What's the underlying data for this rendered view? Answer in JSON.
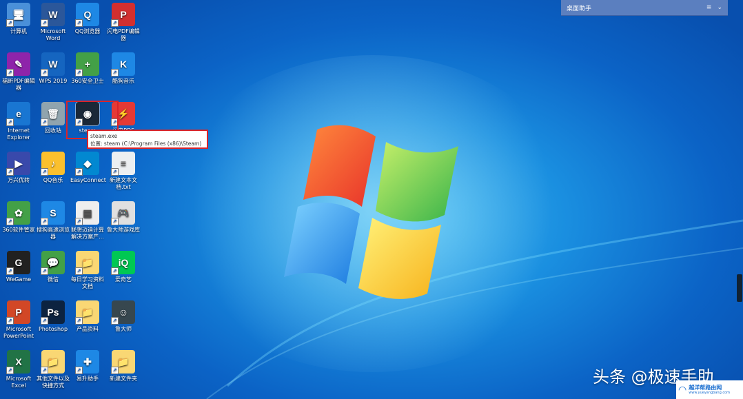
{
  "desktop": {
    "icons": [
      {
        "label": "计算机",
        "icon": "computer-icon",
        "color": "#4a90d9",
        "glyph": "🖥"
      },
      {
        "label": "Microsoft Word",
        "icon": "word-icon",
        "color": "#2b579a",
        "glyph": "W"
      },
      {
        "label": "QQ浏览器",
        "icon": "qq-browser-icon",
        "color": "#1e88e5",
        "glyph": "Q"
      },
      {
        "label": "闪电PDF编辑器",
        "icon": "pdf-editor-icon",
        "color": "#d32f2f",
        "glyph": "P"
      },
      {
        "label": "福昕PDF编辑器",
        "icon": "foxit-icon",
        "color": "#8e24aa",
        "glyph": "✎"
      },
      {
        "label": "WPS 2019",
        "icon": "wps-icon",
        "color": "#1565c0",
        "glyph": "W"
      },
      {
        "label": "360安全卫士",
        "icon": "360-safe-icon",
        "color": "#43a047",
        "glyph": "+"
      },
      {
        "label": "酷狗音乐",
        "icon": "kugou-icon",
        "color": "#1e88e5",
        "glyph": "K"
      },
      {
        "label": "Internet Explorer",
        "icon": "ie-icon",
        "color": "#1976d2",
        "glyph": "e"
      },
      {
        "label": "回收站",
        "icon": "recycle-bin-icon",
        "color": "#90a4ae",
        "glyph": "🗑"
      },
      {
        "label": "steam",
        "icon": "steam-icon",
        "color": "#1b2838",
        "glyph": "◉"
      },
      {
        "label": "闪电PDF",
        "icon": "pdf-icon",
        "color": "#e53935",
        "glyph": "⚡"
      },
      {
        "label": "万兴优转",
        "icon": "converter-icon",
        "color": "#3949ab",
        "glyph": "▶"
      },
      {
        "label": "QQ音乐",
        "icon": "qq-music-icon",
        "color": "#fbc02d",
        "glyph": "♪"
      },
      {
        "label": "EasyConnect",
        "icon": "easyconnect-icon",
        "color": "#0288d1",
        "glyph": "◆"
      },
      {
        "label": "新建文本文档.txt",
        "icon": "text-file-icon",
        "color": "#eceff1",
        "glyph": "≡"
      },
      {
        "label": "360软件管家",
        "icon": "360-manager-icon",
        "color": "#43a047",
        "glyph": "✿"
      },
      {
        "label": "搜狗高速浏览器",
        "icon": "sogou-icon",
        "color": "#1e88e5",
        "glyph": "S"
      },
      {
        "label": "联想迈迪计算解决方案产...",
        "icon": "document-icon",
        "color": "#eeeeee",
        "glyph": "▦"
      },
      {
        "label": "鲁大师游戏库",
        "icon": "gamepad-icon",
        "color": "#e0e0e0",
        "glyph": "🎮"
      },
      {
        "label": "WeGame",
        "icon": "wegame-icon",
        "color": "#212121",
        "glyph": "G"
      },
      {
        "label": "微信",
        "icon": "wechat-icon",
        "color": "#43a047",
        "glyph": "💬"
      },
      {
        "label": "每日学习资料文档",
        "icon": "folder-icon",
        "color": "#f9d774",
        "glyph": "📁"
      },
      {
        "label": "爱奇艺",
        "icon": "iqiyi-icon",
        "color": "#00c853",
        "glyph": "iQ"
      },
      {
        "label": "Microsoft PowerPoint",
        "icon": "powerpoint-icon",
        "color": "#d24726",
        "glyph": "P"
      },
      {
        "label": "Photoshop",
        "icon": "photoshop-icon",
        "color": "#0c2340",
        "glyph": "Ps"
      },
      {
        "label": "产品资料",
        "icon": "folder-icon",
        "color": "#f9d774",
        "glyph": "📁"
      },
      {
        "label": "鲁大师",
        "icon": "ludashi-icon",
        "color": "#37474f",
        "glyph": "☺"
      },
      {
        "label": "Microsoft Excel",
        "icon": "excel-icon",
        "color": "#217346",
        "glyph": "X"
      },
      {
        "label": "其他文件以及快捷方式",
        "icon": "folder-icon",
        "color": "#f9d774",
        "glyph": "📁"
      },
      {
        "label": "易升助手",
        "icon": "upgrade-assistant-icon",
        "color": "#1e88e5",
        "glyph": "✚"
      },
      {
        "label": "新建文件夹",
        "icon": "folder-icon",
        "color": "#f9d774",
        "glyph": "📁"
      }
    ],
    "selected": "steam"
  },
  "tooltip": {
    "title": "steam.exe",
    "location": "位置: steam (C:\\Program Files (x86)\\Steam)"
  },
  "helper": {
    "title": "桌面助手",
    "menu_glyph": "≡",
    "chevron_glyph": "⌄"
  },
  "watermark": {
    "text": "头条 @极速手助",
    "brand_title": "越洋帮路由网",
    "brand_url": "www.yueyangbang.com"
  },
  "colors": {
    "highlight": "#d9242a",
    "helper_bar": "#5b7fbf"
  }
}
